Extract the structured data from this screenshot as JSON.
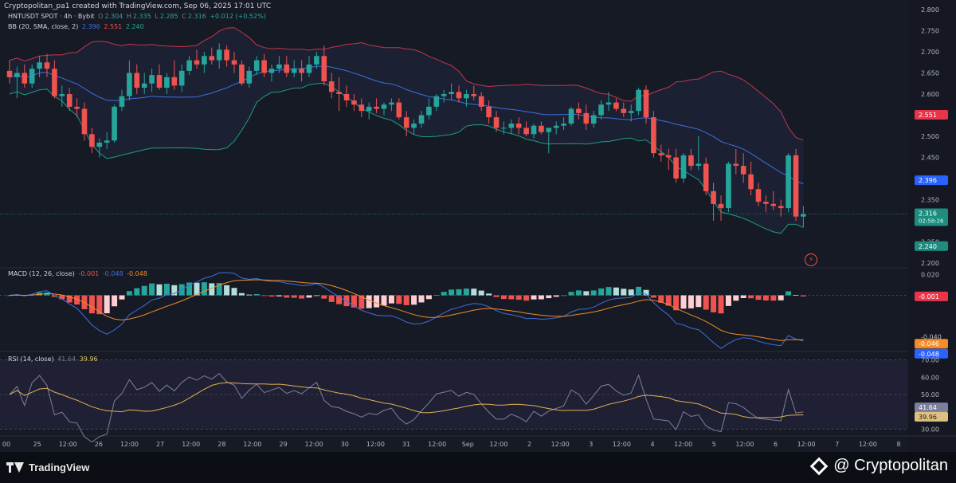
{
  "header": {
    "attribution": "Cryptopolitan_pa1 created with TradingView.com, Sep 06, 2025 17:01 UTC",
    "symbol": "HNTUSDT SPOT · 4h · Bybit",
    "o_label": "O",
    "o_value": "2.304",
    "h_label": "H",
    "h_value": "2.335",
    "l_label": "L",
    "l_value": "2.285",
    "c_label": "C",
    "c_value": "2.316",
    "change": "+0.012 (+0.52%)"
  },
  "bb_legend": {
    "label": "BB (20, SMA, close, 2)",
    "basis": "2.396",
    "upper": "2.551",
    "lower": "2.240"
  },
  "macd_legend": {
    "label": "MACD (12, 26, close)",
    "hist": "-0.001",
    "macd": "-0.048",
    "signal": "-0.048"
  },
  "rsi_legend": {
    "label": "RSI (14, close)",
    "rsi": "41.64",
    "ma": "39.96"
  },
  "footer": {
    "tv_brand": "TradingView",
    "cp_brand": "@ Cryptopolitan"
  },
  "colors": {
    "bg": "#161a25",
    "up": "#26a69a",
    "down": "#ef5350",
    "bb_basis": "#3f6fe0",
    "bb_upper": "#c4364b",
    "bb_lower": "#1e9d7d",
    "macd": "#3f6fe0",
    "signal": "#f28c28",
    "rsi": "#7e7f9a",
    "rsi_ma": "#e0b050"
  },
  "icons": [
    "flash-icon",
    "tradingview-logo-icon",
    "cryptopolitan-logo-icon"
  ],
  "chart_data": [
    {
      "type": "candlestick",
      "title": "HNTUSDT SPOT · 4h · Bybit",
      "ylim": [
        2.2,
        2.8
      ],
      "yticks": [
        "2.800",
        "2.750",
        "2.700",
        "2.650",
        "2.600",
        "2.550",
        "2.500",
        "2.450",
        "2.400",
        "2.350",
        "2.300",
        "2.250",
        "2.200"
      ],
      "x_tick_labels": [
        "00",
        "25",
        "12:00",
        "26",
        "12:00",
        "27",
        "12:00",
        "28",
        "12:00",
        "29",
        "12:00",
        "30",
        "12:00",
        "31",
        "12:00",
        "Sep",
        "12:00",
        "2",
        "12:00",
        "3",
        "12:00",
        "4",
        "12:00",
        "5",
        "12:00",
        "6",
        "12:00",
        "7",
        "12:00",
        "8"
      ],
      "price_badges": {
        "upper": "2.551",
        "basis": "2.396",
        "last": "2.316",
        "countdown": "02:58:26",
        "lower": "2.240"
      },
      "candles": [
        [
          2.655,
          2.68,
          2.625,
          2.64
        ],
        [
          2.64,
          2.665,
          2.59,
          2.65
        ],
        [
          2.65,
          2.67,
          2.615,
          2.625
        ],
        [
          2.625,
          2.67,
          2.615,
          2.66
        ],
        [
          2.66,
          2.69,
          2.64,
          2.675
        ],
        [
          2.675,
          2.695,
          2.64,
          2.66
        ],
        [
          2.66,
          2.68,
          2.59,
          2.595
        ],
        [
          2.595,
          2.62,
          2.57,
          2.6
        ],
        [
          2.6,
          2.615,
          2.56,
          2.57
        ],
        [
          2.57,
          2.59,
          2.545,
          2.565
        ],
        [
          2.565,
          2.58,
          2.49,
          2.505
        ],
        [
          2.505,
          2.52,
          2.46,
          2.475
        ],
        [
          2.475,
          2.495,
          2.45,
          2.485
        ],
        [
          2.485,
          2.51,
          2.47,
          2.49
        ],
        [
          2.49,
          2.575,
          2.485,
          2.57
        ],
        [
          2.57,
          2.61,
          2.56,
          2.595
        ],
        [
          2.595,
          2.68,
          2.585,
          2.65
        ],
        [
          2.65,
          2.67,
          2.6,
          2.615
        ],
        [
          2.615,
          2.65,
          2.6,
          2.625
        ],
        [
          2.625,
          2.66,
          2.605,
          2.645
        ],
        [
          2.645,
          2.67,
          2.61,
          2.615
        ],
        [
          2.615,
          2.65,
          2.6,
          2.64
        ],
        [
          2.64,
          2.68,
          2.61,
          2.62
        ],
        [
          2.62,
          2.67,
          2.605,
          2.655
        ],
        [
          2.655,
          2.69,
          2.645,
          2.68
        ],
        [
          2.68,
          2.705,
          2.66,
          2.67
        ],
        [
          2.67,
          2.7,
          2.65,
          2.69
        ],
        [
          2.69,
          2.71,
          2.67,
          2.68
        ],
        [
          2.68,
          2.72,
          2.66,
          2.705
        ],
        [
          2.705,
          2.715,
          2.665,
          2.68
        ],
        [
          2.68,
          2.7,
          2.65,
          2.67
        ],
        [
          2.67,
          2.68,
          2.62,
          2.625
        ],
        [
          2.625,
          2.665,
          2.615,
          2.655
        ],
        [
          2.655,
          2.69,
          2.645,
          2.68
        ],
        [
          2.68,
          2.695,
          2.64,
          2.65
        ],
        [
          2.65,
          2.67,
          2.63,
          2.66
        ],
        [
          2.66,
          2.69,
          2.65,
          2.67
        ],
        [
          2.67,
          2.69,
          2.64,
          2.65
        ],
        [
          2.65,
          2.68,
          2.64,
          2.66
        ],
        [
          2.66,
          2.68,
          2.63,
          2.65
        ],
        [
          2.65,
          2.69,
          2.64,
          2.67
        ],
        [
          2.67,
          2.7,
          2.66,
          2.69
        ],
        [
          2.69,
          2.715,
          2.62,
          2.63
        ],
        [
          2.63,
          2.65,
          2.59,
          2.605
        ],
        [
          2.605,
          2.64,
          2.56,
          2.6
        ],
        [
          2.6,
          2.62,
          2.57,
          2.585
        ],
        [
          2.585,
          2.6,
          2.56,
          2.575
        ],
        [
          2.575,
          2.59,
          2.545,
          2.56
        ],
        [
          2.56,
          2.58,
          2.54,
          2.57
        ],
        [
          2.57,
          2.59,
          2.555,
          2.565
        ],
        [
          2.565,
          2.58,
          2.55,
          2.575
        ],
        [
          2.575,
          2.59,
          2.56,
          2.58
        ],
        [
          2.58,
          2.59,
          2.54,
          2.545
        ],
        [
          2.545,
          2.56,
          2.5,
          2.52
        ],
        [
          2.52,
          2.54,
          2.505,
          2.53
        ],
        [
          2.53,
          2.56,
          2.52,
          2.55
        ],
        [
          2.55,
          2.59,
          2.54,
          2.57
        ],
        [
          2.57,
          2.6,
          2.56,
          2.595
        ],
        [
          2.595,
          2.61,
          2.58,
          2.6
        ],
        [
          2.6,
          2.625,
          2.585,
          2.605
        ],
        [
          2.605,
          2.62,
          2.58,
          2.59
        ],
        [
          2.59,
          2.61,
          2.57,
          2.6
        ],
        [
          2.6,
          2.62,
          2.585,
          2.595
        ],
        [
          2.595,
          2.605,
          2.56,
          2.57
        ],
        [
          2.57,
          2.585,
          2.53,
          2.545
        ],
        [
          2.545,
          2.56,
          2.51,
          2.52
        ],
        [
          2.52,
          2.535,
          2.505,
          2.52
        ],
        [
          2.52,
          2.54,
          2.505,
          2.53
        ],
        [
          2.53,
          2.545,
          2.505,
          2.52
        ],
        [
          2.52,
          2.535,
          2.5,
          2.505
        ],
        [
          2.505,
          2.53,
          2.495,
          2.525
        ],
        [
          2.525,
          2.535,
          2.505,
          2.51
        ],
        [
          2.51,
          2.52,
          2.46,
          2.52
        ],
        [
          2.52,
          2.535,
          2.505,
          2.525
        ],
        [
          2.525,
          2.545,
          2.515,
          2.53
        ],
        [
          2.53,
          2.57,
          2.525,
          2.565
        ],
        [
          2.565,
          2.58,
          2.54,
          2.555
        ],
        [
          2.555,
          2.575,
          2.515,
          2.53
        ],
        [
          2.53,
          2.56,
          2.52,
          2.55
        ],
        [
          2.55,
          2.585,
          2.54,
          2.575
        ],
        [
          2.575,
          2.605,
          2.56,
          2.58
        ],
        [
          2.58,
          2.59,
          2.56,
          2.565
        ],
        [
          2.565,
          2.58,
          2.545,
          2.555
        ],
        [
          2.555,
          2.575,
          2.535,
          2.56
        ],
        [
          2.56,
          2.615,
          2.55,
          2.61
        ],
        [
          2.61,
          2.62,
          2.53,
          2.545
        ],
        [
          2.545,
          2.56,
          2.45,
          2.46
        ],
        [
          2.46,
          2.48,
          2.44,
          2.455
        ],
        [
          2.455,
          2.47,
          2.42,
          2.45
        ],
        [
          2.45,
          2.47,
          2.39,
          2.4
        ],
        [
          2.4,
          2.46,
          2.39,
          2.455
        ],
        [
          2.455,
          2.47,
          2.42,
          2.43
        ],
        [
          2.43,
          2.5,
          2.42,
          2.435
        ],
        [
          2.435,
          2.45,
          2.36,
          2.37
        ],
        [
          2.37,
          2.39,
          2.3,
          2.34
        ],
        [
          2.34,
          2.36,
          2.3,
          2.33
        ],
        [
          2.33,
          2.44,
          2.32,
          2.435
        ],
        [
          2.435,
          2.47,
          2.41,
          2.43
        ],
        [
          2.43,
          2.46,
          2.39,
          2.41
        ],
        [
          2.41,
          2.44,
          2.36,
          2.375
        ],
        [
          2.375,
          2.39,
          2.335,
          2.345
        ],
        [
          2.345,
          2.36,
          2.32,
          2.34
        ],
        [
          2.34,
          2.37,
          2.325,
          2.335
        ],
        [
          2.335,
          2.35,
          2.31,
          2.33
        ],
        [
          2.33,
          2.46,
          2.32,
          2.455
        ],
        [
          2.455,
          2.47,
          2.3,
          2.31
        ],
        [
          2.31,
          2.335,
          2.285,
          2.316
        ]
      ]
    },
    {
      "type": "macd",
      "title": "MACD (12, 26, close)",
      "ylim": [
        -0.052,
        0.022
      ],
      "yticks": [
        "0.020",
        "-0.040"
      ],
      "badges": {
        "hist": "-0.001",
        "signal": "-0.046",
        "macd": "-0.048"
      }
    },
    {
      "type": "line",
      "title": "RSI (14, close)",
      "ylim": [
        27,
        73
      ],
      "yticks": [
        "70.00",
        "60.00",
        "50.00",
        "40.00",
        "30.00"
      ],
      "badges": {
        "rsi": "41.64",
        "ma": "39.96"
      }
    }
  ]
}
